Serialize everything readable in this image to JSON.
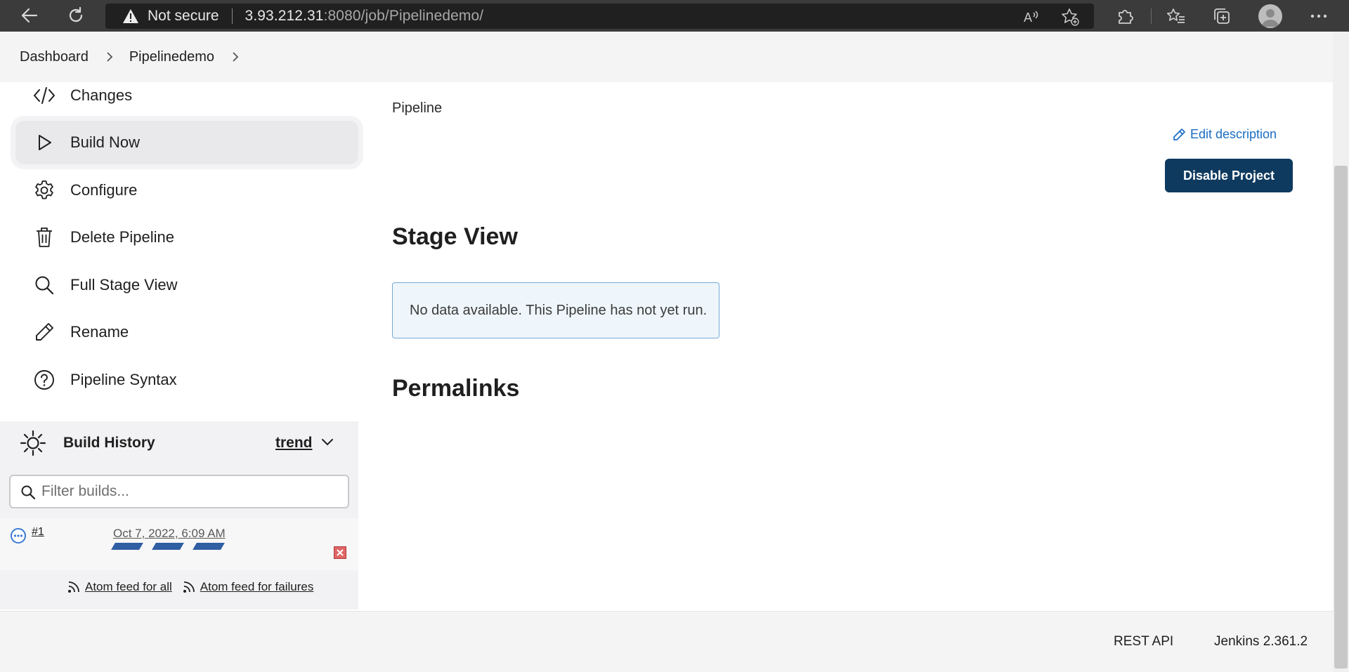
{
  "browser": {
    "security_label": "Not secure",
    "url_host": "3.93.212.31",
    "url_path": ":8080/job/Pipelinedemo/"
  },
  "breadcrumb": {
    "items": [
      "Dashboard",
      "Pipelinedemo"
    ]
  },
  "sidebar": {
    "items": [
      {
        "label": "Changes",
        "icon": "code-icon"
      },
      {
        "label": "Build Now",
        "icon": "play-icon"
      },
      {
        "label": "Configure",
        "icon": "gear-icon"
      },
      {
        "label": "Delete Pipeline",
        "icon": "trash-icon"
      },
      {
        "label": "Full Stage View",
        "icon": "search-icon"
      },
      {
        "label": "Rename",
        "icon": "pencil-icon"
      },
      {
        "label": "Pipeline Syntax",
        "icon": "help-icon"
      }
    ],
    "active_item": "Build Now"
  },
  "build_history": {
    "title": "Build History",
    "trend_label": "trend",
    "filter_placeholder": "Filter builds...",
    "builds": [
      {
        "number": "#1",
        "date": "Oct 7, 2022, 6:09 AM",
        "status": "in-progress"
      }
    ],
    "atom_all": "Atom feed for all",
    "atom_failures": "Atom feed for failures"
  },
  "main": {
    "description": "Pipeline",
    "edit_description": "Edit description",
    "disable_button": "Disable Project",
    "stage_view_heading": "Stage View",
    "stage_view_message": "No data available. This Pipeline has not yet run.",
    "permalinks_heading": "Permalinks"
  },
  "footer": {
    "rest_api": "REST API",
    "version": "Jenkins 2.361.2"
  },
  "colors": {
    "primary_button": "#0f3a5f",
    "link": "#1a6dc2",
    "progress": "#2f5ea3",
    "browser_chrome": "#3b3b3b"
  }
}
